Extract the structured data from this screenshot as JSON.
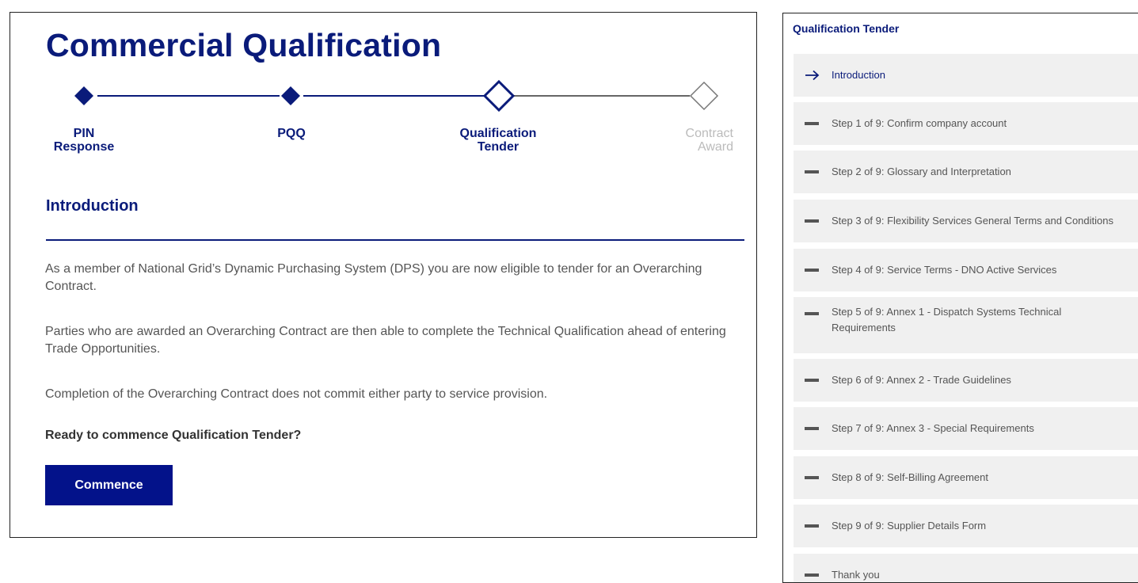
{
  "main": {
    "title": "Commercial Qualification",
    "stepper": [
      {
        "label": "PIN\nResponse",
        "state": "complete"
      },
      {
        "label": "PQQ",
        "state": "complete"
      },
      {
        "label": "Qualification\nTender",
        "state": "current"
      },
      {
        "label": "Contract\nAward",
        "state": "future"
      }
    ],
    "section_heading": "Introduction",
    "paragraphs": [
      "As a member of National Grid’s Dynamic Purchasing System (DPS) you are now eligible to tender for an Overarching Contract.",
      "Parties who are awarded an Overarching Contract are then able to complete the Technical Qualification ahead of entering Trade Opportunities.",
      "Completion of the Overarching Contract does not commit either party to service provision."
    ],
    "ready_text": "Ready to commence Qualification Tender?",
    "commence_label": "Commence"
  },
  "sidebar": {
    "title": "Qualification Tender",
    "items": [
      {
        "label": "Introduction",
        "icon": "arrow-right-icon",
        "active": true
      },
      {
        "label": "Step 1 of 9: Confirm company account",
        "icon": "dash-icon"
      },
      {
        "label": "Step 2 of 9: Glossary and Interpretation",
        "icon": "dash-icon"
      },
      {
        "label": "Step 3 of 9: Flexibility Services General Terms and Conditions",
        "icon": "dash-icon"
      },
      {
        "label": "Step 4 of 9: Service Terms - DNO Active Services",
        "icon": "dash-icon"
      },
      {
        "label": "Step 5 of 9: Annex 1 - Dispatch Systems Technical Requirements",
        "icon": "dash-icon"
      },
      {
        "label": "Step 6 of 9: Annex 2 - Trade Guidelines",
        "icon": "dash-icon"
      },
      {
        "label": "Step 7 of 9: Annex 3 - Special Requirements",
        "icon": "dash-icon"
      },
      {
        "label": "Step 8 of 9: Self-Billing Agreement",
        "icon": "dash-icon"
      },
      {
        "label": "Step 9 of 9: Supplier Details Form",
        "icon": "dash-icon"
      },
      {
        "label": "Thank you",
        "icon": "dash-icon"
      }
    ]
  },
  "colors": {
    "brand_navy": "#0a1b7a",
    "button_navy": "#03128a",
    "sidebar_item_bg": "#f0f0f0",
    "future_step": "#bbbbbb"
  }
}
